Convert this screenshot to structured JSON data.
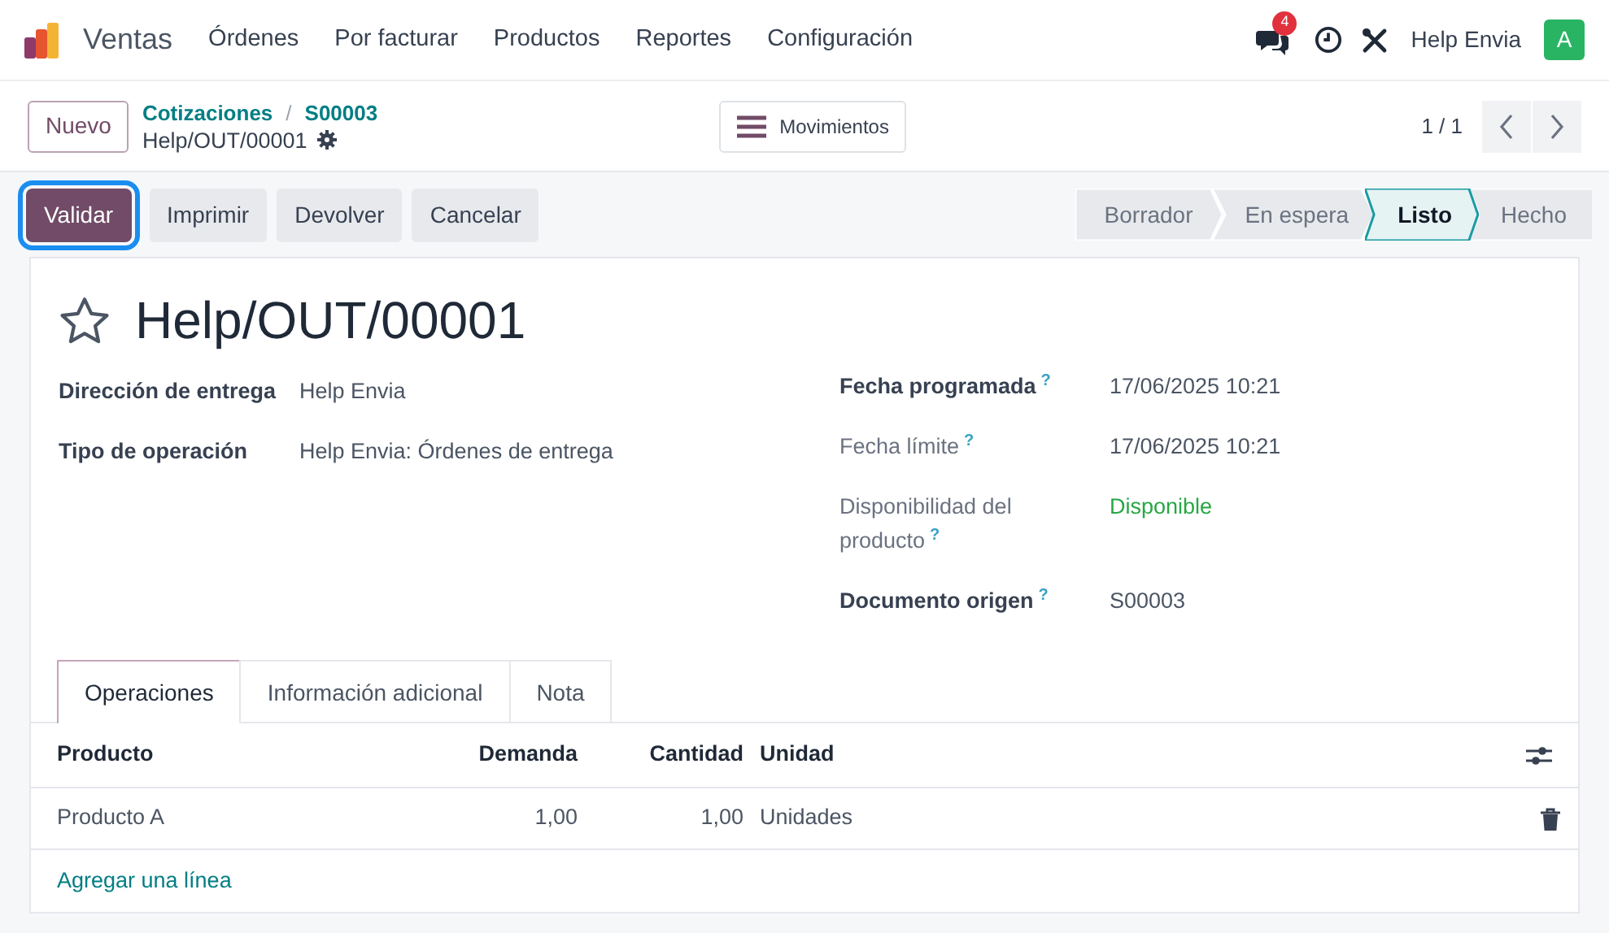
{
  "navbar": {
    "app_name": "Ventas",
    "menu": [
      "Órdenes",
      "Por facturar",
      "Productos",
      "Reportes",
      "Configuración"
    ],
    "chat_badge": "4",
    "user_name": "Help Envia",
    "avatar_letter": "A"
  },
  "control_panel": {
    "new_button": "Nuevo",
    "breadcrumbs": [
      "Cotizaciones",
      "S00003"
    ],
    "separator": "/",
    "record_name": "Help/OUT/00001",
    "moves_button": "Movimientos",
    "pager": "1 / 1"
  },
  "status_bar": {
    "buttons": [
      {
        "label": "Validar",
        "kind": "primary",
        "focused": true
      },
      {
        "label": "Imprimir",
        "kind": "secondary",
        "focused": false
      },
      {
        "label": "Devolver",
        "kind": "secondary",
        "focused": false
      },
      {
        "label": "Cancelar",
        "kind": "secondary",
        "focused": false
      }
    ],
    "stages": [
      {
        "label": "Borrador",
        "selected": false
      },
      {
        "label": "En espera",
        "selected": false
      },
      {
        "label": "Listo",
        "selected": true
      },
      {
        "label": "Hecho",
        "selected": false
      }
    ]
  },
  "form": {
    "title": "Help/OUT/00001",
    "starred": false,
    "left_fields": [
      {
        "label": "Dirección de entrega",
        "value": "Help Envia"
      },
      {
        "label": "Tipo de operación",
        "value": "Help Envia: Órdenes de entrega"
      }
    ],
    "right_fields": [
      {
        "label": "Fecha programada",
        "help": "?",
        "required": true,
        "value": "17/06/2025 10:21",
        "kind": "text"
      },
      {
        "label": "Fecha límite",
        "help": "?",
        "required": false,
        "value": "17/06/2025 10:21",
        "kind": "text"
      },
      {
        "label": "Disponibilidad del producto",
        "help": "?",
        "required": false,
        "value": "Disponible",
        "kind": "status"
      },
      {
        "label": "Documento origen",
        "help": "?",
        "required": true,
        "value": "S00003",
        "kind": "text"
      }
    ],
    "tabs": [
      {
        "label": "Operaciones",
        "selected": true
      },
      {
        "label": "Información adicional",
        "selected": false
      },
      {
        "label": "Nota",
        "selected": false
      }
    ],
    "table": {
      "columns": [
        "Producto",
        "Demanda",
        "Cantidad",
        "Unidad"
      ],
      "rows": [
        [
          "Producto A",
          "1,00",
          "1,00",
          "Unidades"
        ]
      ],
      "add_line": "Agregar una línea"
    }
  }
}
